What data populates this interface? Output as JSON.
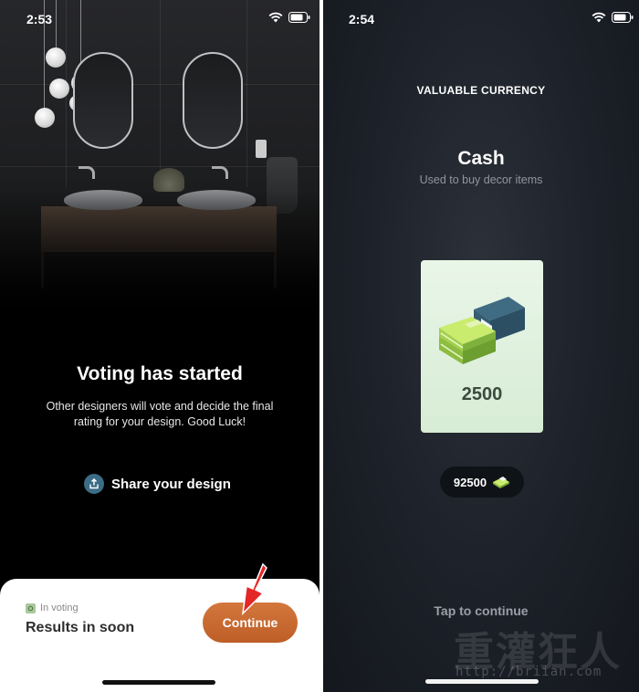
{
  "left_screen": {
    "status_time": "2:53",
    "title": "Voting has started",
    "description": "Other designers will vote and decide the final rating for your design. Good Luck!",
    "share_label": "Share your design",
    "sheet": {
      "status_label": "In voting",
      "results_text": "Results in soon",
      "continue_label": "Continue"
    }
  },
  "right_screen": {
    "status_time": "2:54",
    "section_label": "VALUABLE CURRENCY",
    "currency_title": "Cash",
    "currency_subtitle": "Used to buy decor items",
    "card_amount": "2500",
    "balance": "92500",
    "tap_to_continue": "Tap to continue"
  },
  "watermark": {
    "text": "重灌狂人",
    "url": "http://briian.com"
  },
  "colors": {
    "continue_button": "#c96a30",
    "share_icon_bg": "#3c6c86",
    "cash_card_bg": "#e2f1e0"
  },
  "icons": [
    "wifi-icon",
    "battery-icon",
    "share-icon",
    "in-voting-icon",
    "cash-stack-icon",
    "small-cash-icon",
    "red-arrow-pointer"
  ]
}
